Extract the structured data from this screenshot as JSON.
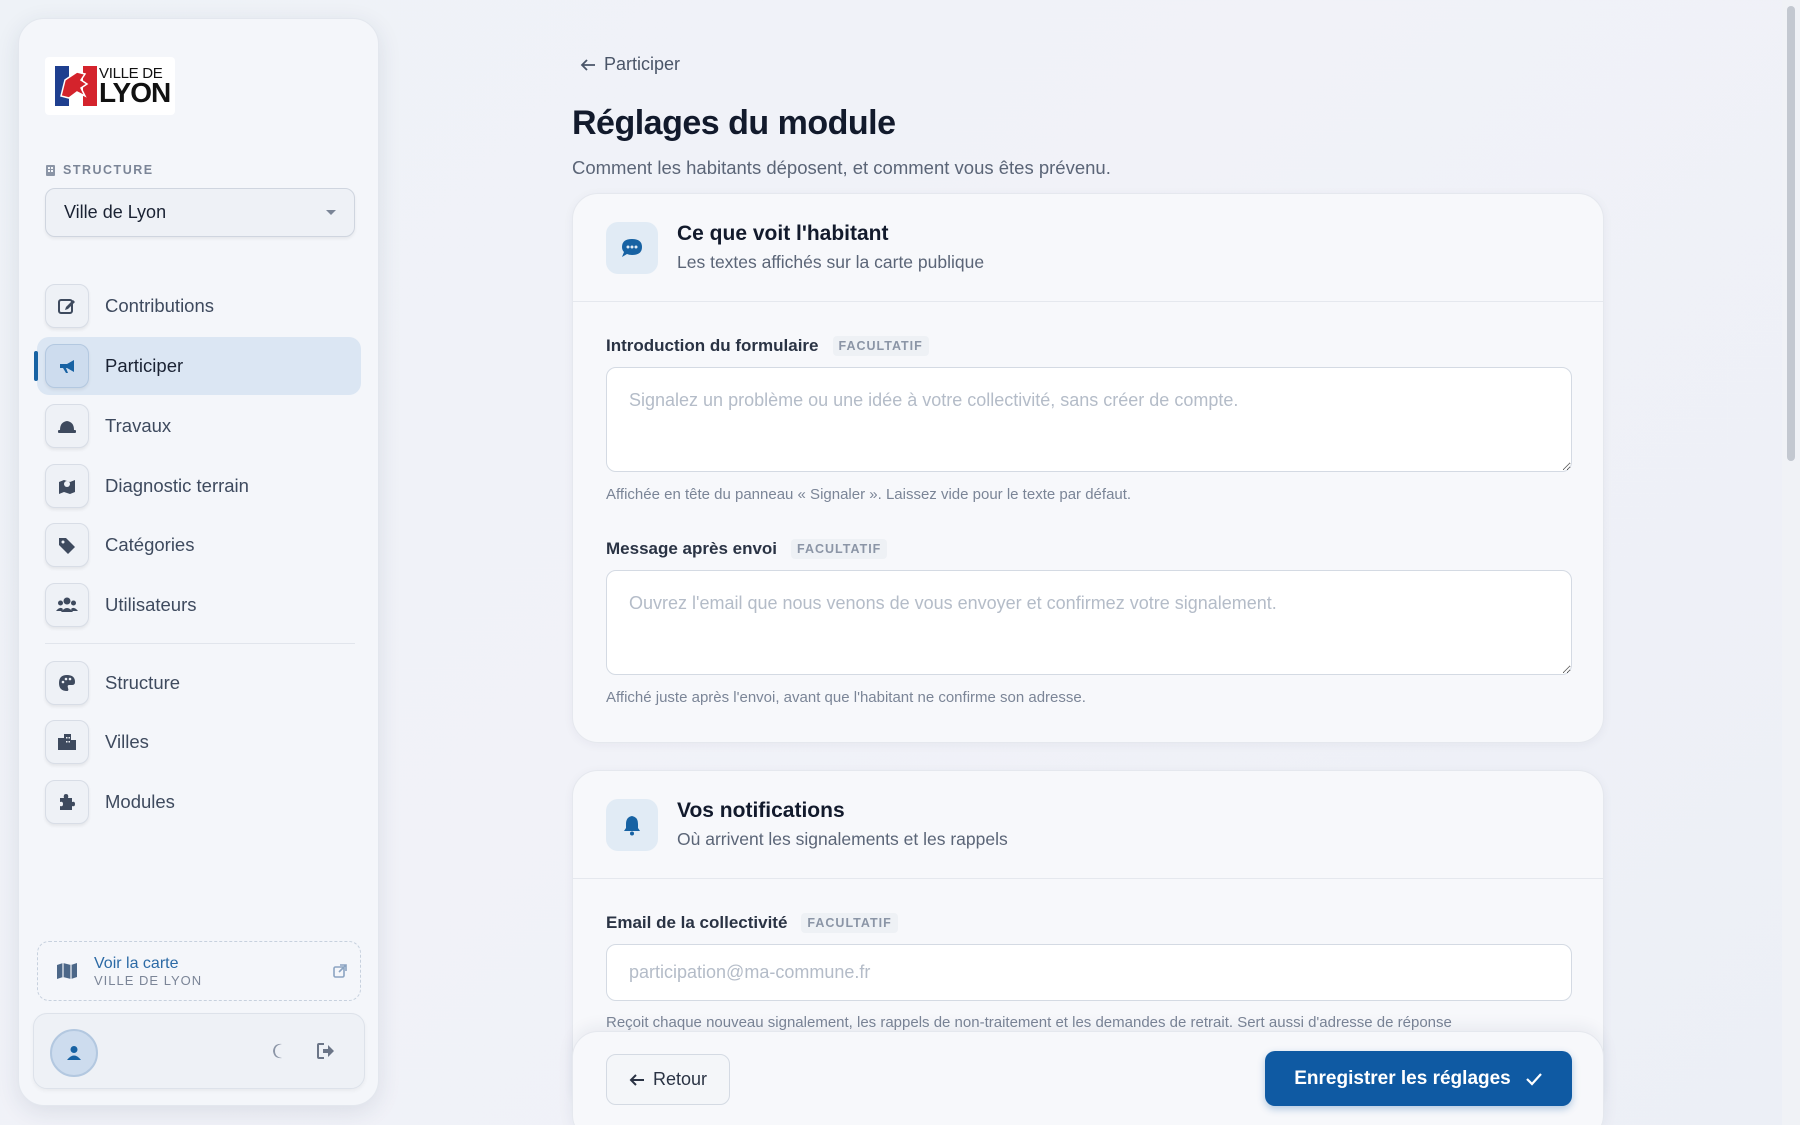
{
  "sidebar": {
    "logo": {
      "line1": "VILLE DE",
      "line2": "LYON"
    },
    "structure_label": "STRUCTURE",
    "structure_select_value": "Ville de Lyon",
    "nav_items": [
      {
        "label": "Contributions",
        "icon": "edit-icon"
      },
      {
        "label": "Participer",
        "icon": "megaphone-icon",
        "active": true
      },
      {
        "label": "Travaux",
        "icon": "hard-hat-icon"
      },
      {
        "label": "Diagnostic terrain",
        "icon": "map-pin-icon"
      },
      {
        "label": "Catégories",
        "icon": "tags-icon"
      },
      {
        "label": "Utilisateurs",
        "icon": "users-icon"
      },
      {
        "label": "Structure",
        "icon": "palette-icon"
      },
      {
        "label": "Villes",
        "icon": "city-icon"
      },
      {
        "label": "Modules",
        "icon": "puzzle-icon"
      }
    ],
    "map_link": {
      "title": "Voir la carte",
      "subtitle": "VILLE DE LYON"
    }
  },
  "breadcrumb": {
    "back_label": "Participer"
  },
  "page": {
    "title": "Réglages du module",
    "subtitle": "Comment les habitants déposent, et comment vous êtes prévenu."
  },
  "card_public": {
    "title": "Ce que voit l'habitant",
    "subtitle": "Les textes affichés sur la carte publique",
    "fields": [
      {
        "label": "Introduction du formulaire",
        "badge": "FACULTATIF",
        "placeholder": "Signalez un problème ou une idée à votre collectivité, sans créer de compte.",
        "help": "Affichée en tête du panneau « Signaler ». Laissez vide pour le texte par défaut."
      },
      {
        "label": "Message après envoi",
        "badge": "FACULTATIF",
        "placeholder": "Ouvrez l'email que nous venons de vous envoyer et confirmez votre signalement.",
        "help": "Affiché juste après l'envoi, avant que l'habitant ne confirme son adresse."
      }
    ]
  },
  "card_notifications": {
    "title": "Vos notifications",
    "subtitle": "Où arrivent les signalements et les rappels",
    "email_field": {
      "label": "Email de la collectivité",
      "badge": "FACULTATIF",
      "placeholder": "participation@ma-commune.fr",
      "help": "Reçoit chaque nouveau signalement, les rappels de non-traitement et les demandes de retrait. Sert aussi d'adresse de réponse"
    }
  },
  "footer": {
    "back_label": "Retour",
    "save_label": "Enregistrer les réglages"
  },
  "colors": {
    "accent": "#0f5aa3",
    "active_bg": "#dbe6f3"
  }
}
